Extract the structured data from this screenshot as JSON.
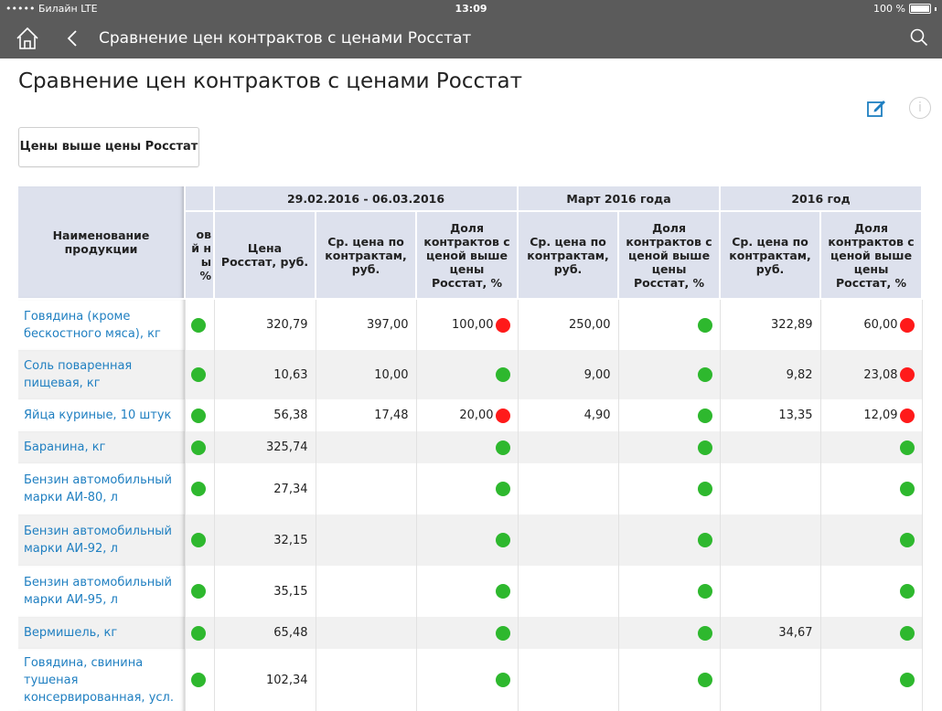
{
  "status": {
    "carrier": "••••• Билайн  LTE",
    "time": "13:09",
    "battery": "100 %"
  },
  "nav": {
    "title": "Сравнение цен контрактов с ценами Росстат"
  },
  "page": {
    "title": "Сравнение цен контрактов с ценами Росстат",
    "filter_label": "Цены выше цены Росстат",
    "info_glyph": "i"
  },
  "colors": {
    "green": "#2eb82e",
    "red": "#ff1a1a",
    "header_bg": "#dde1ed",
    "link": "#1f7fc1"
  },
  "table": {
    "name_header": "Наименование продукции",
    "cut_header": "ов й ны %",
    "groups": [
      {
        "label": "29.02.2016 - 06.03.2016"
      },
      {
        "label": "Март 2016 года"
      },
      {
        "label": "2016 год"
      }
    ],
    "sub": {
      "rosstat": "Цена Росстат, руб.",
      "avg": "Ср. цена по контрактам, руб.",
      "share": "Доля контрактов с ценой выше цены Росстат, %"
    },
    "rows": [
      {
        "name": "Говядина (кроме бескостного мяса), кг",
        "p0": "green",
        "rosstat": "320,79",
        "avg1": "397,00",
        "share1": "100,00",
        "s1": "red",
        "avg2": "250,00",
        "s2": "green",
        "avg3": "322,89",
        "share3": "60,00",
        "s3": "red"
      },
      {
        "name": "Соль поваренная пищевая, кг",
        "p0": "green",
        "rosstat": "10,63",
        "avg1": "10,00",
        "share1": "",
        "s1": "green",
        "avg2": "9,00",
        "s2": "green",
        "avg3": "9,82",
        "share3": "23,08",
        "s3": "red"
      },
      {
        "name": "Яйца куриные, 10 штук",
        "p0": "green",
        "rosstat": "56,38",
        "avg1": "17,48",
        "share1": "20,00",
        "s1": "red",
        "avg2": "4,90",
        "s2": "green",
        "avg3": "13,35",
        "share3": "12,09",
        "s3": "red"
      },
      {
        "name": "Баранина, кг",
        "p0": "green",
        "rosstat": "325,74",
        "avg1": "",
        "share1": "",
        "s1": "green",
        "avg2": "",
        "s2": "green",
        "avg3": "",
        "share3": "",
        "s3": "green"
      },
      {
        "name": "Бензин автомобильный марки АИ-80, л",
        "p0": "green",
        "rosstat": "27,34",
        "avg1": "",
        "share1": "",
        "s1": "green",
        "avg2": "",
        "s2": "green",
        "avg3": "",
        "share3": "",
        "s3": "green"
      },
      {
        "name": "Бензин автомобильный марки АИ-92, л",
        "p0": "green",
        "rosstat": "32,15",
        "avg1": "",
        "share1": "",
        "s1": "green",
        "avg2": "",
        "s2": "green",
        "avg3": "",
        "share3": "",
        "s3": "green"
      },
      {
        "name": "Бензин автомобильный марки АИ-95, л",
        "p0": "green",
        "rosstat": "35,15",
        "avg1": "",
        "share1": "",
        "s1": "green",
        "avg2": "",
        "s2": "green",
        "avg3": "",
        "share3": "",
        "s3": "green"
      },
      {
        "name": "Вермишель, кг",
        "p0": "green",
        "rosstat": "65,48",
        "avg1": "",
        "share1": "",
        "s1": "green",
        "avg2": "",
        "s2": "green",
        "avg3": "34,67",
        "share3": "",
        "s3": "green"
      },
      {
        "name": "Говядина, свинина тушеная консервированная, усл.",
        "p0": "green",
        "rosstat": "102,34",
        "avg1": "",
        "share1": "",
        "s1": "green",
        "avg2": "",
        "s2": "green",
        "avg3": "",
        "share3": "",
        "s3": "green"
      }
    ]
  }
}
